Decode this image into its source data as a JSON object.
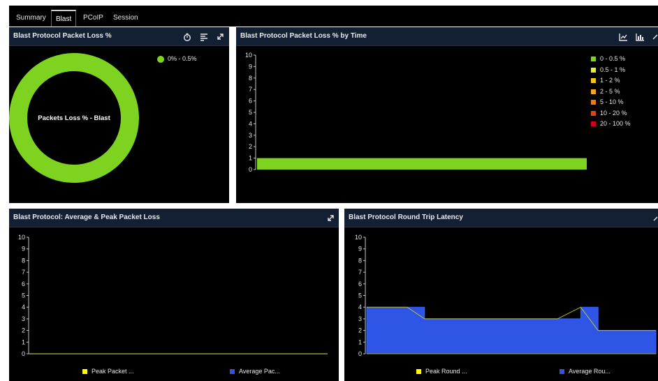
{
  "tabs": [
    "Summary",
    "Blast",
    "PCoIP",
    "Session"
  ],
  "panels": {
    "packet_loss": {
      "title": "Blast Protocol Packet Loss %",
      "center_label": "Packets Loss % - Blast",
      "legend": [
        {
          "label": "0% - 0.5%",
          "color": "#7ed321"
        }
      ],
      "icons": [
        "timer-icon",
        "list-icon",
        "expand-icon"
      ]
    },
    "packet_loss_time": {
      "title": "Blast Protocol Packet Loss % by Time",
      "icons": [
        "line-chart-icon",
        "bar-chart-icon",
        "expand-icon"
      ]
    },
    "avg_peak_loss": {
      "title": "Blast Protocol: Average & Peak Packet Loss",
      "legend": [
        {
          "label": "Peak Packet ...",
          "color": "#ffff00"
        },
        {
          "label": "Average Pac...",
          "color": "#2f55e6"
        }
      ],
      "icons": [
        "expand-icon"
      ]
    },
    "latency": {
      "title": "Blast Protocol Round Trip Latency",
      "legend": [
        {
          "label": "Peak Round ...",
          "color": "#ffff00"
        },
        {
          "label": "Average Rou...",
          "color": "#2f55e6"
        }
      ],
      "icons": [
        "expand-icon"
      ]
    }
  },
  "chart_data": [
    {
      "type": "pie",
      "title": "Blast Protocol Packet Loss %",
      "center_label": "Packets Loss % - Blast",
      "slices": [
        {
          "label": "0% - 0.5%",
          "value": 100,
          "color": "#7ed321"
        }
      ]
    },
    {
      "type": "bar",
      "title": "Blast Protocol Packet Loss % by Time",
      "ylim": [
        0,
        10
      ],
      "yticks": [
        0,
        1,
        2,
        3,
        4,
        5,
        6,
        7,
        8,
        9,
        10
      ],
      "legend": [
        {
          "label": "0 - 0.5 %",
          "color": "#7ed321"
        },
        {
          "label": "0.5 - 1 %",
          "color": "#e6ee3a"
        },
        {
          "label": "1 - 2 %",
          "color": "#f5c518"
        },
        {
          "label": "2 - 5 %",
          "color": "#f5a623"
        },
        {
          "label": "5 - 10 %",
          "color": "#f07a1a"
        },
        {
          "label": "10 - 20 %",
          "color": "#d9480f"
        },
        {
          "label": "20 - 100 %",
          "color": "#d0021b"
        }
      ],
      "series": [
        {
          "name": "0 - 0.5 %",
          "values": [
            1
          ]
        }
      ]
    },
    {
      "type": "line",
      "title": "Blast Protocol: Average & Peak Packet Loss",
      "ylim": [
        0,
        10
      ],
      "yticks": [
        0,
        1,
        2,
        3,
        4,
        5,
        6,
        7,
        8,
        9,
        10
      ],
      "series": [
        {
          "name": "Peak Packet ...",
          "values": [
            0,
            0
          ]
        },
        {
          "name": "Average Pac...",
          "values": [
            0,
            0
          ]
        }
      ]
    },
    {
      "type": "area",
      "title": "Blast Protocol Round Trip Latency",
      "ylim": [
        0,
        10
      ],
      "yticks": [
        0,
        1,
        2,
        3,
        4,
        5,
        6,
        7,
        8,
        9,
        10
      ],
      "x": [
        0,
        0.14,
        0.2,
        0.2,
        0.66,
        0.74,
        0.74,
        0.8,
        0.8,
        1.0
      ],
      "series": [
        {
          "name": "Peak Round ...",
          "values": [
            4,
            4,
            3,
            3,
            3,
            4,
            4,
            2,
            2,
            2
          ]
        },
        {
          "name": "Average Rou...",
          "values": [
            4,
            4,
            4,
            3,
            3,
            3,
            4,
            4,
            2,
            2
          ]
        }
      ]
    }
  ]
}
